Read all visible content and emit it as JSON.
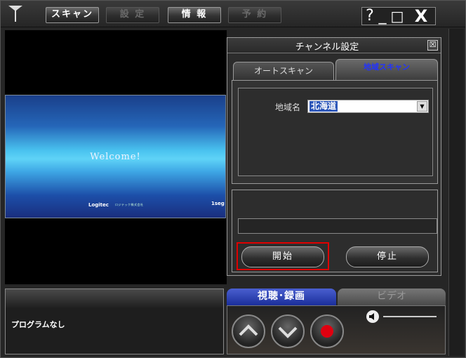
{
  "toolbar": {
    "scan_label": "スキャン",
    "settings_label": "設 定",
    "info_label": "情 報",
    "reserve_label": "予 約"
  },
  "window_controls": {
    "help": "?",
    "minimize": "_",
    "maximize": "□",
    "close": "X"
  },
  "preview": {
    "welcome_text": "Welcome!",
    "brand": "Logitec",
    "subtitle": "ロジテック株式会社",
    "mark": "1seg"
  },
  "dialog": {
    "title": "チャンネル設定",
    "close": "☒",
    "tabs": [
      {
        "label": "オートスキャン",
        "active": false
      },
      {
        "label": "地域スキャン",
        "active": true
      }
    ],
    "region_label": "地域名",
    "region_value": "北海道",
    "progress": 0,
    "start_label": "開始",
    "stop_label": "停止"
  },
  "program": {
    "text": "プログラムなし"
  },
  "bottom_tabs": [
    {
      "label": "視聴･録画",
      "active": true
    },
    {
      "label": "ビデオ",
      "active": false
    }
  ],
  "colors": {
    "accent_blue": "#2b55b8",
    "highlight_red": "#e00000",
    "active_tab_text": "#2233ff"
  },
  "icons": {
    "logo": "antenna-icon",
    "channel_up": "chevron-up-icon",
    "channel_down": "chevron-down-icon",
    "record": "record-icon",
    "speaker": "speaker-icon"
  }
}
